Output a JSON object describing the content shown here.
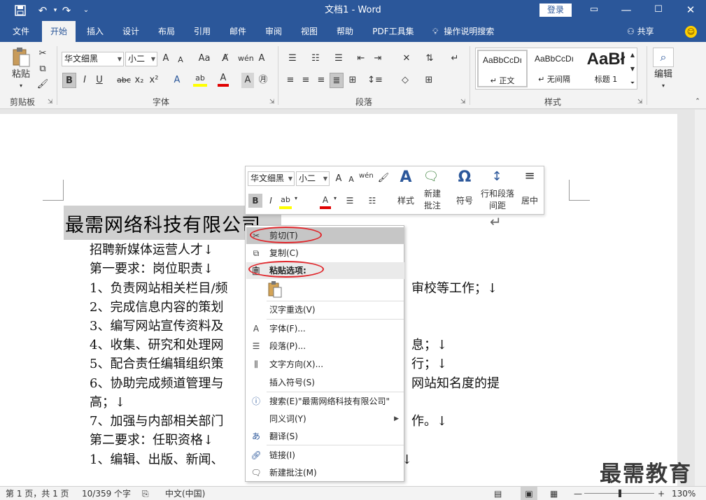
{
  "titlebar": {
    "title": "文档1 - Word",
    "login": "登录",
    "save_icon": "save-icon",
    "undo_icon": "undo-icon",
    "redo_icon": "redo-icon"
  },
  "tabs": [
    "文件",
    "开始",
    "插入",
    "设计",
    "布局",
    "引用",
    "邮件",
    "审阅",
    "视图",
    "帮助",
    "PDF工具集"
  ],
  "tell_me": "操作说明搜索",
  "share": "共享",
  "ribbon": {
    "clipboard": {
      "label": "剪贴板",
      "paste": "粘贴"
    },
    "font": {
      "label": "字体",
      "font_name": "华文细黑",
      "font_size": "小二",
      "bold": "B",
      "italic": "I",
      "underline": "U",
      "strike": "abc",
      "sub": "x₂",
      "sup": "x²",
      "grow": "A",
      "shrink": "A",
      "change_case": "Aa"
    },
    "paragraph": {
      "label": "段落"
    },
    "styles": {
      "label": "样式",
      "items": [
        {
          "sample": "AaBbCcDı",
          "name": "↵ 正文"
        },
        {
          "sample": "AaBbCcDı",
          "name": "↵ 无间隔"
        },
        {
          "sample": "AaBł",
          "name": "标题 1"
        }
      ]
    },
    "editing": {
      "label": "编辑"
    }
  },
  "document": {
    "heading": "最需网络科技有限公司",
    "lines": [
      "招聘新媒体运营人才↓",
      "第一要求：岗位职责↓",
      "1、负责网站相关栏目/频",
      "审校等工作；↓",
      "2、完成信息内容的策划",
      "3、编写网站宣传资料及",
      "4、收集、研究和处理网",
      "息；↓",
      "5、配合责任编辑组织策",
      "行；↓",
      "6、协助完成频道管理与",
      "网站知名度的提",
      "高；↓",
      "7、加强与内部相关部门",
      "作。↓",
      "第二要求：任职资格↓",
      "1、编辑、出版、新闻、",
      "↓"
    ]
  },
  "minibar": {
    "font_name": "华文细黑",
    "font_size": "小二",
    "styles": "样式",
    "new_comment": [
      "新建",
      "批注"
    ],
    "symbol": "符号",
    "line_spacing": [
      "行和段落",
      "间距"
    ],
    "center": "居中"
  },
  "context_menu": {
    "items": [
      {
        "label": "剪切(T)",
        "icon": "scissors-icon"
      },
      {
        "label": "复制(C)",
        "icon": "copy-icon"
      },
      {
        "label": "粘贴选项:",
        "icon": "paste-icon"
      },
      {
        "label": "汉字重选(V)",
        "icon": ""
      },
      {
        "label": "字体(F)...",
        "icon": "font-icon"
      },
      {
        "label": "段落(P)...",
        "icon": "paragraph-icon"
      },
      {
        "label": "文字方向(X)...",
        "icon": "text-direction-icon"
      },
      {
        "label": "插入符号(S)",
        "icon": ""
      },
      {
        "label": "搜索(E)\"最需网络科技有限公司\"",
        "icon": "search-icon"
      },
      {
        "label": "同义词(Y)",
        "icon": ""
      },
      {
        "label": "翻译(S)",
        "icon": "translate-icon"
      },
      {
        "label": "链接(I)",
        "icon": "link-icon"
      },
      {
        "label": "新建批注(M)",
        "icon": "comment-icon"
      }
    ]
  },
  "statusbar": {
    "page": "第 1 页，共 1 页",
    "words": "10/359 个字",
    "language": "中文(中国)",
    "zoom": "130%"
  },
  "watermark": "最需教育",
  "colors": {
    "brand": "#2b579a",
    "annotation": "#e0262b"
  }
}
